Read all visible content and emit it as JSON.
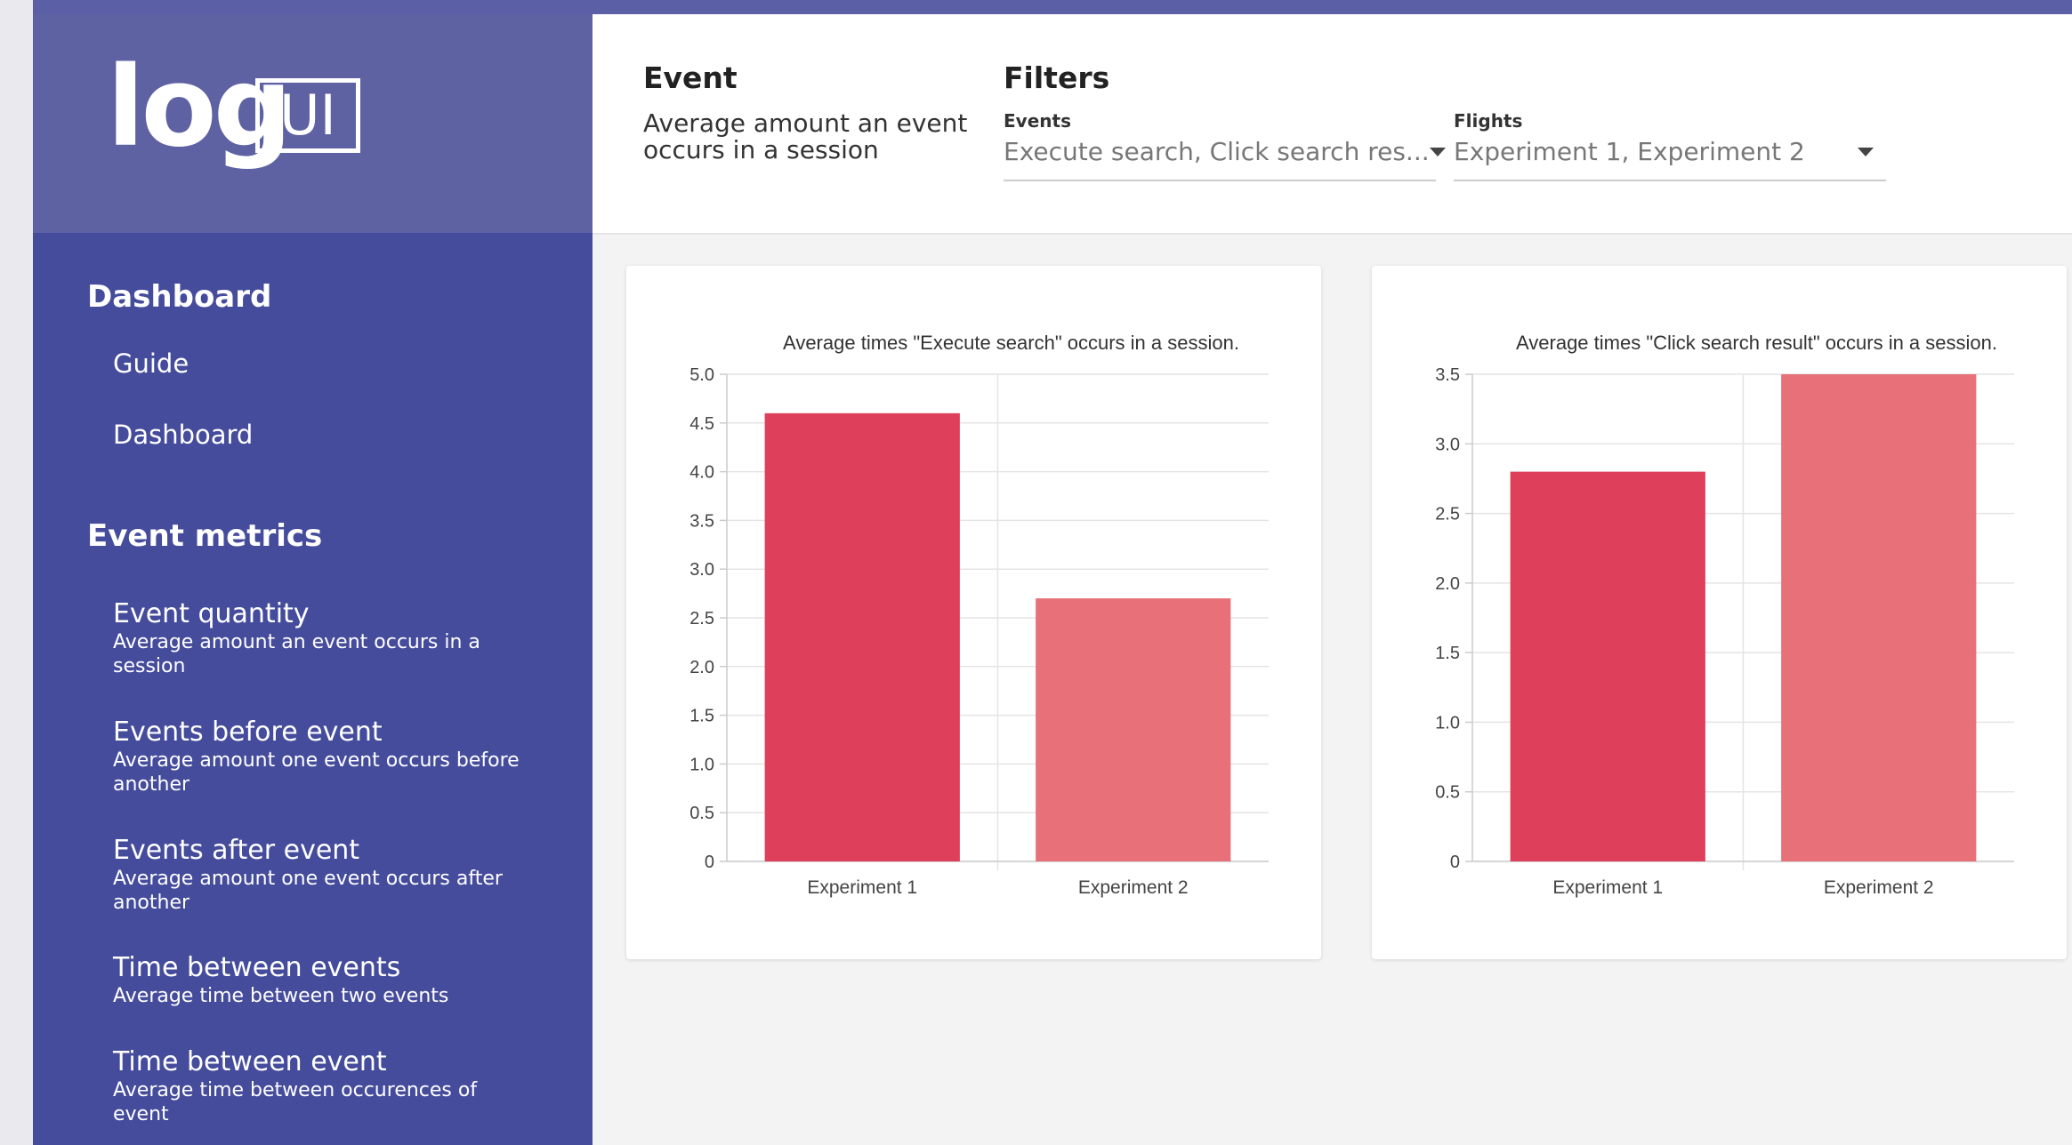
{
  "brand": {
    "log": "log",
    "ui": "UI"
  },
  "sidebar": {
    "dashboard_heading": "Dashboard",
    "links": [
      {
        "label": "Guide"
      },
      {
        "label": "Dashboard"
      }
    ],
    "metrics_heading": "Event metrics",
    "metrics": [
      {
        "title": "Event quantity",
        "sub": "Average amount an event occurs in a session"
      },
      {
        "title": "Events before event",
        "sub": "Average amount one event occurs before another"
      },
      {
        "title": "Events after event",
        "sub": "Average amount one event occurs after another"
      },
      {
        "title": "Time between events",
        "sub": "Average time between two events"
      },
      {
        "title": "Time between event",
        "sub": "Average time between occurences of event"
      }
    ]
  },
  "header": {
    "event_title": "Event",
    "event_desc": "Average amount an event occurs in a session",
    "filters_title": "Filters",
    "events_label": "Events",
    "events_value": "Execute search, Click search res...",
    "flights_label": "Flights",
    "flights_value": "Experiment 1, Experiment 2"
  },
  "colors": {
    "bar1": "#de3f5a",
    "bar2": "#e87179",
    "sidebar": "#454c9c",
    "logo_bg": "#5e62a3"
  },
  "chart_data": [
    {
      "type": "bar",
      "title": "Average times \"Execute search\" occurs in a session.",
      "categories": [
        "Experiment 1",
        "Experiment 2"
      ],
      "values": [
        4.6,
        2.7
      ],
      "ylim": [
        0,
        5
      ],
      "yticks": [
        "0",
        "0.5",
        "1.0",
        "1.5",
        "2.0",
        "2.5",
        "3.0",
        "3.5",
        "4.0",
        "4.5",
        "5.0"
      ],
      "grid": true
    },
    {
      "type": "bar",
      "title": "Average times \"Click search result\" occurs in a session.",
      "categories": [
        "Experiment 1",
        "Experiment 2"
      ],
      "values": [
        2.8,
        3.5
      ],
      "ylim": [
        0,
        3.5
      ],
      "yticks": [
        "0",
        "0.5",
        "1.0",
        "1.5",
        "2.0",
        "2.5",
        "3.0",
        "3.5"
      ],
      "grid": true
    }
  ]
}
